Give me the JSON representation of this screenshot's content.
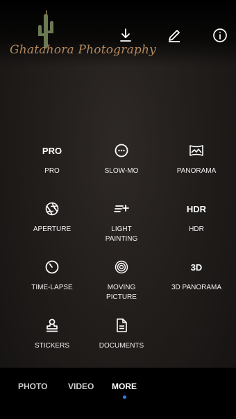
{
  "logo": {
    "text": "Ghatahora Photography"
  },
  "toolbar": {
    "download_icon": "download-icon",
    "edit_icon": "pencil-icon",
    "info_icon": "info-icon"
  },
  "modes": [
    {
      "icon_text": "PRO",
      "label": "PRO"
    },
    {
      "icon": "slow-mo-icon",
      "label": "SLOW-MO"
    },
    {
      "icon": "panorama-icon",
      "label": "PANORAMA"
    },
    {
      "icon": "aperture-icon",
      "label": "APERTURE"
    },
    {
      "icon": "light-painting-icon",
      "label_lines": [
        "LIGHT",
        "PAINTING"
      ]
    },
    {
      "icon_text": "HDR",
      "label": "HDR"
    },
    {
      "icon": "time-lapse-icon",
      "label": "TIME-LAPSE"
    },
    {
      "icon": "moving-picture-icon",
      "label_lines": [
        "MOVING",
        "PICTURE"
      ]
    },
    {
      "icon_text": "3D",
      "label": "3D PANORAMA"
    },
    {
      "icon": "stickers-icon",
      "label": "STICKERS"
    },
    {
      "icon": "documents-icon",
      "label": "DOCUMENTS"
    }
  ],
  "tabs": [
    {
      "label": "PHOTO"
    },
    {
      "label": "VIDEO"
    },
    {
      "label": "MORE",
      "active": true
    }
  ],
  "colors": {
    "accent_dot": "#2f7de1",
    "logo_text": "#b48a5e"
  }
}
